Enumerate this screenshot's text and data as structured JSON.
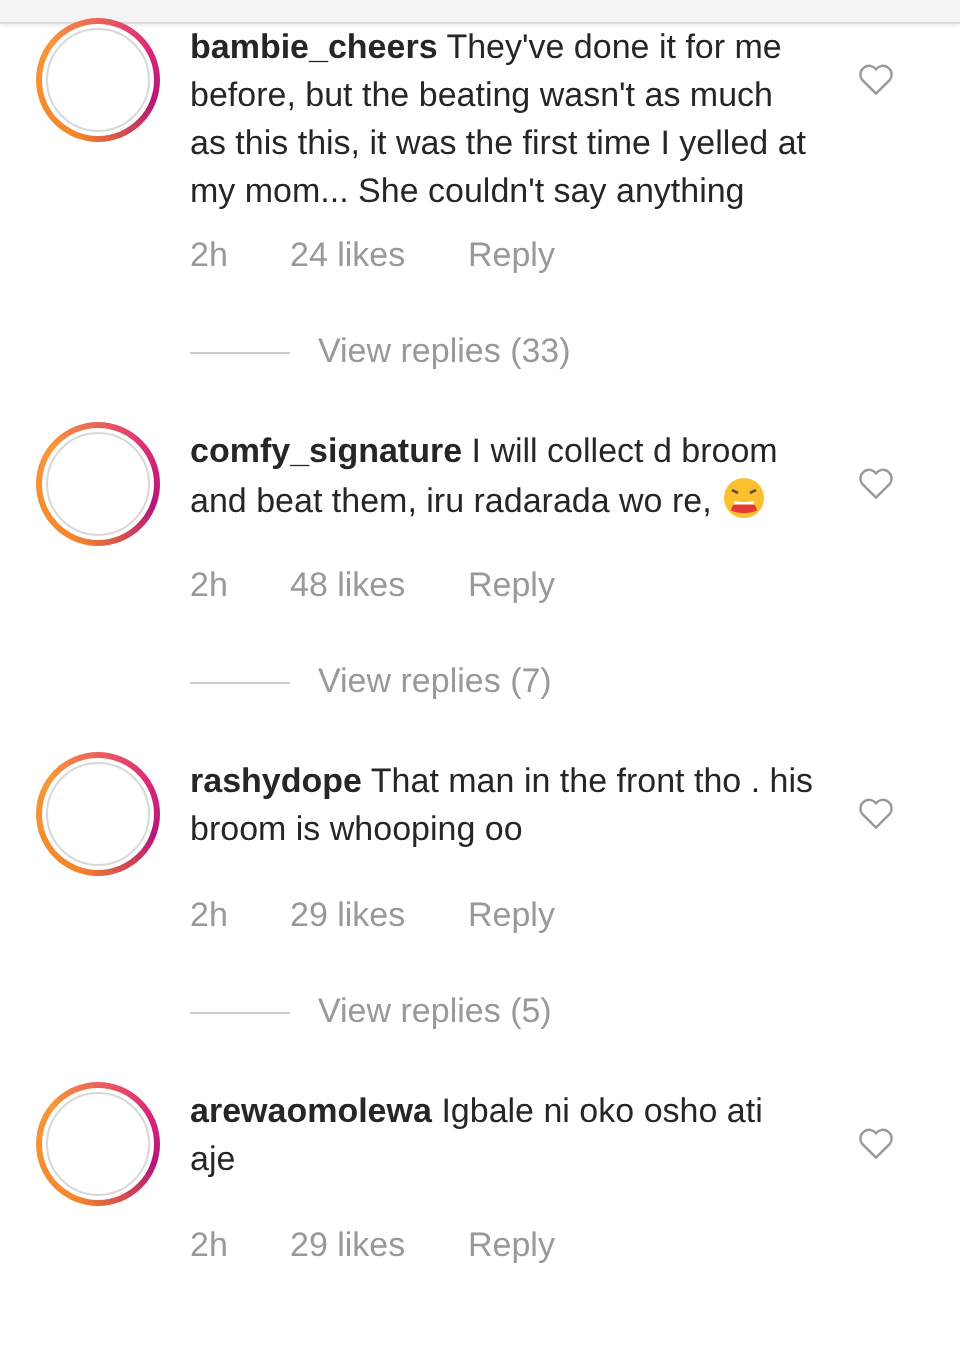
{
  "comments": [
    {
      "username": "bambie_cheers",
      "text": "They've done it for me before, but the beating wasn't as much as this this,  it was the first time I yelled at my mom... She couldn't say anything",
      "emoji": false,
      "liked": false,
      "time": "2h",
      "likes": "24 likes",
      "reply": "Reply",
      "view_replies": "View replies (33)"
    },
    {
      "username": "comfy_signature",
      "text": "I will collect d broom and beat them, iru radarada wo re,",
      "emoji": true,
      "liked": false,
      "time": "2h",
      "likes": "48 likes",
      "reply": "Reply",
      "view_replies": "View replies (7)"
    },
    {
      "username": "rashydope",
      "text": "That man in the front tho . his broom is whooping oo",
      "emoji": false,
      "liked": false,
      "time": "2h",
      "likes": "29 likes",
      "reply": "Reply",
      "view_replies": "View replies (5)"
    },
    {
      "username": "arewaomolewa",
      "text": "Igbale ni oko osho ati aje",
      "emoji": false,
      "liked": false,
      "time": "2h",
      "likes": "29 likes",
      "reply": "Reply"
    }
  ]
}
